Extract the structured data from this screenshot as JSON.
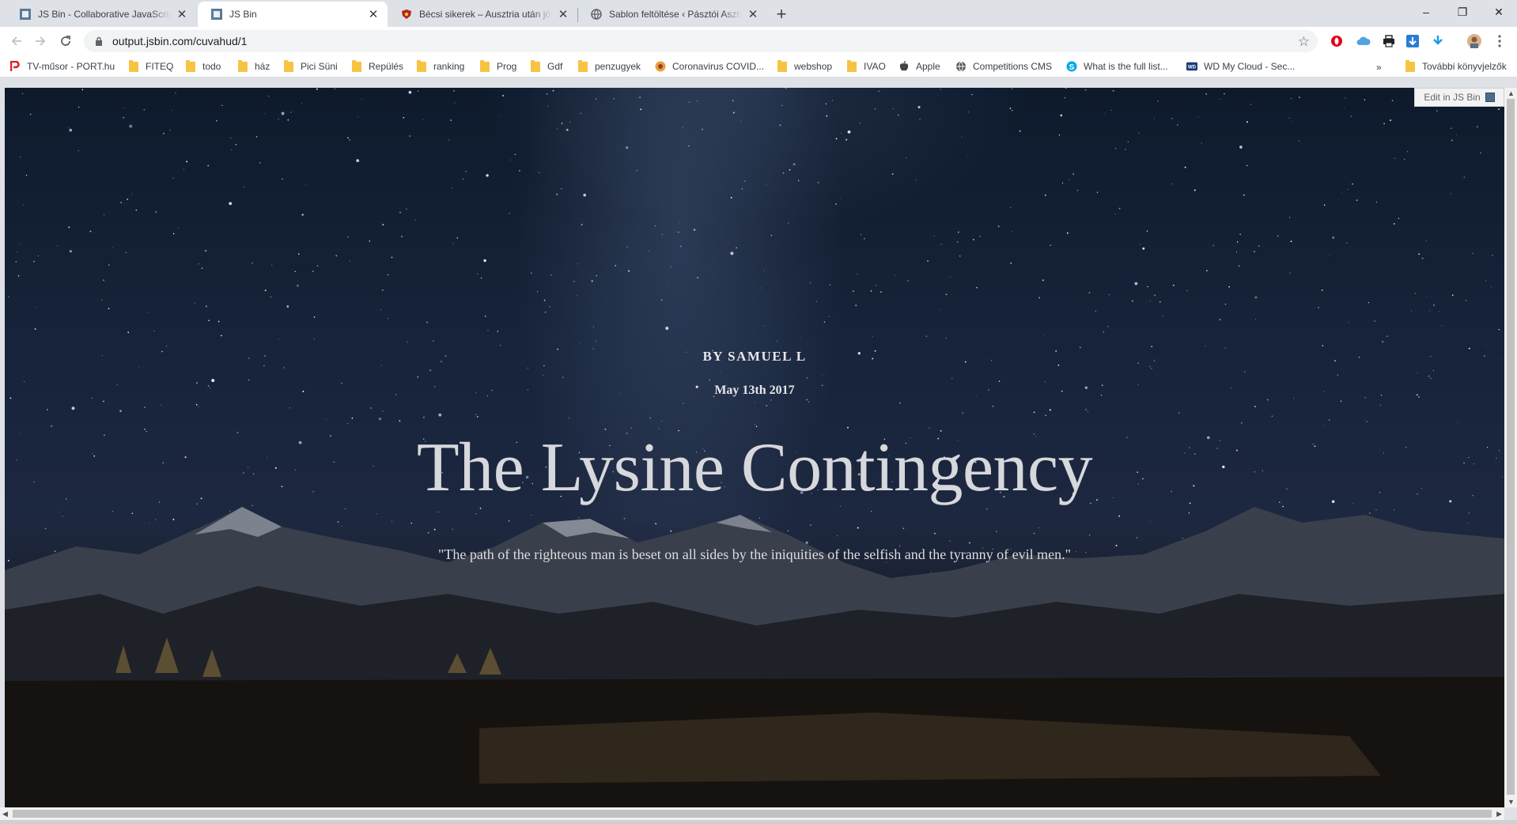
{
  "tabs": [
    {
      "title": "JS Bin - Collaborative JavaScript Debugging",
      "icon": "jsbin-icon",
      "active": false
    },
    {
      "title": "JS Bin",
      "icon": "jsbin-icon",
      "active": true
    },
    {
      "title": "Bécsi sikerek – Ausztria után jöhet Magyarország",
      "icon": "shield-icon",
      "active": false
    },
    {
      "title": "Sablon feltöltése ‹ Pásztói Asztalitenisz",
      "icon": "globe-icon",
      "active": false
    }
  ],
  "new_tab_label": "+",
  "window_controls": {
    "minimize": "–",
    "maximize": "❐",
    "close": "✕"
  },
  "toolbar": {
    "url": "output.jsbin.com/cuvahud/1"
  },
  "bookmarks": [
    {
      "label": "TV-műsor - PORT.hu",
      "icon": "port-icon"
    },
    {
      "label": "FITEQ",
      "icon": "folder-icon"
    },
    {
      "label": "todo",
      "icon": "folder-icon"
    },
    {
      "label": "ház",
      "icon": "folder-icon"
    },
    {
      "label": "Pici Süni",
      "icon": "folder-icon"
    },
    {
      "label": "Repülés",
      "icon": "folder-icon"
    },
    {
      "label": "ranking",
      "icon": "folder-icon"
    },
    {
      "label": "Prog",
      "icon": "folder-icon"
    },
    {
      "label": "Gdf",
      "icon": "folder-icon"
    },
    {
      "label": "penzugyek",
      "icon": "folder-icon"
    },
    {
      "label": "Coronavirus COVID...",
      "icon": "covid-icon"
    },
    {
      "label": "webshop",
      "icon": "folder-icon"
    },
    {
      "label": "IVAO",
      "icon": "folder-icon"
    },
    {
      "label": "Apple",
      "icon": "apple-icon"
    },
    {
      "label": "Competitions CMS",
      "icon": "globe-icon"
    },
    {
      "label": "What is the full list...",
      "icon": "skype-icon"
    },
    {
      "label": "WD My Cloud - Sec...",
      "icon": "wd-icon"
    }
  ],
  "bookmarks_more": "»",
  "other_bookmarks": "További könyvjelzők",
  "page": {
    "byline": "BY SAMUEL L",
    "date": "May 13th 2017",
    "headline": "The Lysine Contingency",
    "quote": "\"The path of the righteous man is beset on all sides by the iniquities of the selfish and the tyranny of evil men.\"",
    "edit_link": "Edit in JS Bin"
  }
}
